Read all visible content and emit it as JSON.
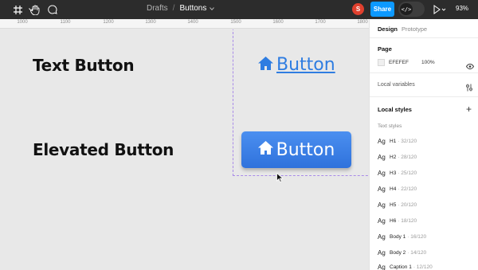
{
  "toolbar": {
    "breadcrumb_project": "Drafts",
    "breadcrumb_separator": "/",
    "file_name": "Buttons",
    "avatar_initial": "S",
    "share_label": "Share",
    "devmode_glyph": "</>",
    "zoom": "93%"
  },
  "ruler": {
    "ticks": [
      "1000",
      "1100",
      "1200",
      "1300",
      "1400",
      "1500",
      "1600",
      "1700",
      "1800"
    ]
  },
  "canvas": {
    "heading_text_button": "Text Button",
    "heading_elevated_button": "Elevated Button",
    "text_button_label": "Button",
    "elevated_button_label": "Button"
  },
  "panel": {
    "tab_design": "Design",
    "tab_prototype": "Prototype",
    "page_title": "Page",
    "page_color": "EFEFEF",
    "page_opacity": "100%",
    "local_variables": "Local variables",
    "local_styles": "Local styles",
    "text_styles": "Text styles",
    "styles": [
      {
        "ag": "Ag",
        "name": "H1",
        "size": "· 32/120"
      },
      {
        "ag": "Ag",
        "name": "H2",
        "size": "· 28/120"
      },
      {
        "ag": "Ag",
        "name": "H3",
        "size": "· 25/120"
      },
      {
        "ag": "Ag",
        "name": "H4",
        "size": "· 22/120"
      },
      {
        "ag": "Ag",
        "name": "H5",
        "size": "· 20/120"
      },
      {
        "ag": "Ag",
        "name": "H6",
        "size": "· 18/120"
      },
      {
        "ag": "Ag",
        "name": "Body 1",
        "size": "· 16/120"
      },
      {
        "ag": "Ag",
        "name": "Body 2",
        "size": "· 14/120"
      },
      {
        "ag": "Ag",
        "name": "Caption 1",
        "size": "· 12/120"
      }
    ]
  },
  "colors": {
    "toolbar_bg": "#2c2c2c",
    "canvas_bg": "#e8e8e8",
    "accent_blue": "#0d99ff",
    "button_blue": "#2f7de1",
    "frame_outline": "#a98be8",
    "avatar_red": "#e0402e"
  },
  "icons": {
    "toolbar": [
      "move-tool-icon",
      "frame-tool-icon",
      "hand-tool-icon",
      "comment-icon"
    ],
    "play": "play-icon",
    "home": "home-icon"
  }
}
